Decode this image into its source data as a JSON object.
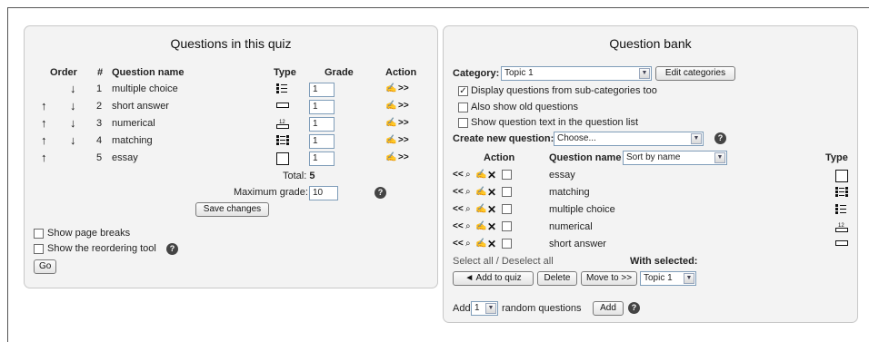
{
  "quiz": {
    "title": "Questions in this quiz",
    "headers": {
      "order": "Order",
      "num": "#",
      "name": "Question name",
      "type": "Type",
      "grade": "Grade",
      "action": "Action"
    },
    "rows": [
      {
        "num": "1",
        "name": "multiple choice",
        "type_icon": "multichoice-icon",
        "grade": "1",
        "up": false,
        "down": true
      },
      {
        "num": "2",
        "name": "short answer",
        "type_icon": "shortanswer-icon",
        "grade": "1",
        "up": true,
        "down": true
      },
      {
        "num": "3",
        "name": "numerical",
        "type_icon": "numerical-icon",
        "grade": "1",
        "up": true,
        "down": true
      },
      {
        "num": "4",
        "name": "matching",
        "type_icon": "matching-icon",
        "grade": "1",
        "up": true,
        "down": true
      },
      {
        "num": "5",
        "name": "essay",
        "type_icon": "essay-icon",
        "grade": "1",
        "up": true,
        "down": false
      }
    ],
    "total_label": "Total:",
    "total_value": "5",
    "max_grade_label": "Maximum grade:",
    "max_grade_value": "10",
    "save_label": "Save changes",
    "show_page_breaks": "Show page breaks",
    "show_reorder": "Show the reordering tool",
    "go_label": "Go"
  },
  "bank": {
    "title": "Question bank",
    "category_label": "Category:",
    "category_value": "Topic 1",
    "edit_categories": "Edit categories",
    "opt_subcats": "Display questions from sub-categories too",
    "opt_subcats_checked": true,
    "opt_old": "Also show old questions",
    "opt_text": "Show question text in the question list",
    "create_label": "Create new question:",
    "create_value": "Choose...",
    "headers": {
      "action": "Action",
      "name": "Question name",
      "type": "Type"
    },
    "sort_value": "Sort by name",
    "rows": [
      {
        "name": "essay",
        "type_icon": "essay-icon"
      },
      {
        "name": "matching",
        "type_icon": "matching-icon"
      },
      {
        "name": "multiple choice",
        "type_icon": "multichoice-icon"
      },
      {
        "name": "numerical",
        "type_icon": "numerical-icon"
      },
      {
        "name": "short answer",
        "type_icon": "shortanswer-icon"
      }
    ],
    "select_all": "Select all",
    "deselect_all": "Deselect all",
    "with_selected": "With selected:",
    "add_to_quiz": "◄ Add to quiz",
    "delete": "Delete",
    "move_to": "Move to >>",
    "move_target": "Topic 1",
    "add_label": "Add",
    "random_count": "1",
    "random_label": "random questions",
    "add_button": "Add"
  }
}
